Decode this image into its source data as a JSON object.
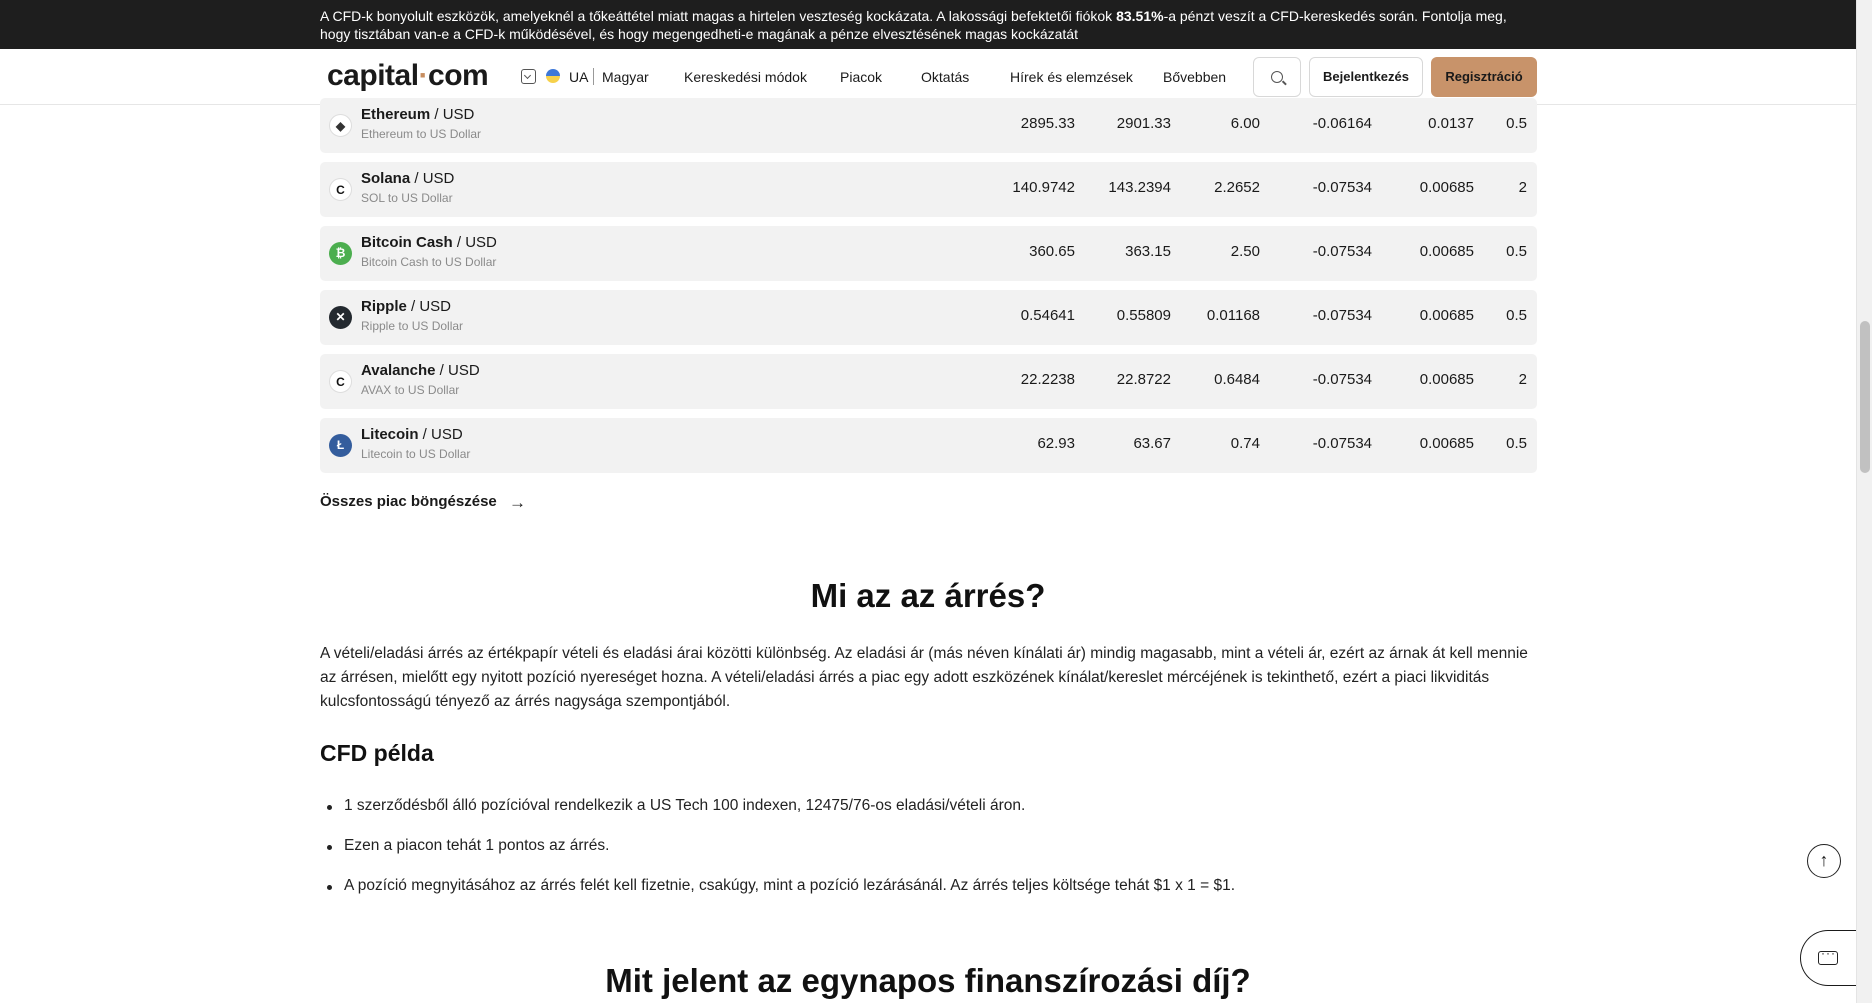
{
  "risk_banner": {
    "text_before": "A CFD-k bonyolult eszközök, amelyeknél a tőkeáttétel miatt magas a hirtelen veszteség kockázata. A lakossági befektetői fiókok ",
    "percent": "83.51%",
    "text_after": "-a pénzt veszít a CFD-kereskedés során. Fontolja meg, hogy tisztában van-e a CFD-k működésével, és hogy megengedheti-e magának a pénze elvesztésének magas kockázatát"
  },
  "header": {
    "logo_left": "capital",
    "logo_dot": "·",
    "logo_right": "com",
    "lang_code": "UA",
    "lang_name": "Magyar",
    "nav": [
      "Kereskedési módok",
      "Piacok",
      "Oktatás",
      "Hírek és elemzések",
      "Bővebben"
    ],
    "login": "Bejelentkezés",
    "register": "Regisztráció",
    "register_color": "#c8936a"
  },
  "markets": [
    {
      "name": "Ethereum",
      "pair": " / USD",
      "sub": "Ethereum to US Dollar",
      "icon": "ethereum-icon",
      "glyph": "◆",
      "icon_bg": "#ffffff",
      "icon_fg": "#333333",
      "sell": "2895.33",
      "buy": "2901.33",
      "spread": "6.00",
      "long_fee": "-0.06164",
      "short_fee": "0.0137",
      "margin": "0.5"
    },
    {
      "name": "Solana",
      "pair": " / USD",
      "sub": "SOL to US Dollar",
      "icon": "solana-icon",
      "glyph": "C",
      "icon_bg": "#ffffff",
      "icon_fg": "#111111",
      "sell": "140.9742",
      "buy": "143.2394",
      "spread": "2.2652",
      "long_fee": "-0.07534",
      "short_fee": "0.00685",
      "margin": "2"
    },
    {
      "name": "Bitcoin Cash",
      "pair": " / USD",
      "sub": "Bitcoin Cash to US Dollar",
      "icon": "bitcoin-cash-icon",
      "glyph": "₿",
      "icon_bg": "#4cae4f",
      "icon_fg": "#ffffff",
      "sell": "360.65",
      "buy": "363.15",
      "spread": "2.50",
      "long_fee": "-0.07534",
      "short_fee": "0.00685",
      "margin": "0.5"
    },
    {
      "name": "Ripple",
      "pair": " / USD",
      "sub": "Ripple to US Dollar",
      "icon": "ripple-icon",
      "glyph": "✕",
      "icon_bg": "#23292f",
      "icon_fg": "#ffffff",
      "sell": "0.54641",
      "buy": "0.55809",
      "spread": "0.01168",
      "long_fee": "-0.07534",
      "short_fee": "0.00685",
      "margin": "0.5"
    },
    {
      "name": "Avalanche",
      "pair": " / USD",
      "sub": "AVAX to US Dollar",
      "icon": "avalanche-icon",
      "glyph": "C",
      "icon_bg": "#ffffff",
      "icon_fg": "#111111",
      "sell": "22.2238",
      "buy": "22.8722",
      "spread": "0.6484",
      "long_fee": "-0.07534",
      "short_fee": "0.00685",
      "margin": "2"
    },
    {
      "name": "Litecoin",
      "pair": " / USD",
      "sub": "Litecoin to US Dollar",
      "icon": "litecoin-icon",
      "glyph": "Ł",
      "icon_bg": "#345d9d",
      "icon_fg": "#ffffff",
      "sell": "62.93",
      "buy": "63.67",
      "spread": "0.74",
      "long_fee": "-0.07534",
      "short_fee": "0.00685",
      "margin": "0.5"
    }
  ],
  "browse_all": "Összes piac böngészése",
  "section_spread": {
    "title": "Mi az az árrés?",
    "paragraph": "A vételi/eladási árrés az értékpapír vételi és eladási árai közötti különbség. Az eladási ár (más néven kínálati ár) mindig magasabb, mint a vételi ár, ezért az árnak át kell mennie az árrésen, mielőtt egy nyitott pozíció nyereséget hozna. A vételi/eladási árrés a piac egy adott eszközének kínálat/kereslet mércéjének is tekinthető, ezért a piaci likviditás kulcsfontosságú tényező az árrés nagysága szempontjából."
  },
  "cfd_example": {
    "title": "CFD példa",
    "bullets": [
      "1 szerződésből álló pozícióval rendelkezik a US Tech 100 indexen, 12475/76-os eladási/vételi áron.",
      "Ezen a piacon tehát 1 pontos az árrés.",
      "A pozíció megnyitásához az árrés felét kell fizetnie, csakúgy, mint a pozíció lezárásánál. Az árrés teljes költsége tehát $1 x 1 = $1."
    ]
  },
  "next_section_title": "Mit jelent az egynapos finanszírozási díj?"
}
